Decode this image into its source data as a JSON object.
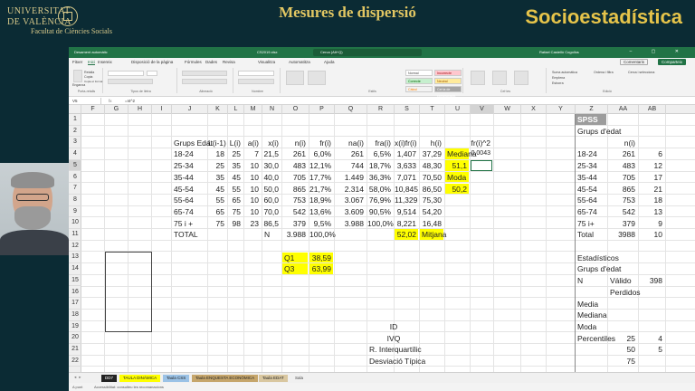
{
  "header": {
    "logo_line1": "UNIVERSITAT",
    "logo_line2": "DE VALÈNCIA",
    "logo_faculty": "Facultat de Ciències Socials",
    "title": "Mesures de dispersió",
    "brand": "Socioestadística"
  },
  "excel": {
    "titlebar": {
      "autosave": "Desament automàtic",
      "file": "CS2019.xlsx",
      "search": "Cerca (Alt+Q)",
      "user": "Rafael Castellò Cogollos",
      "controls": "–  ▢  ✕"
    },
    "menu": {
      "items": [
        "Fitxer",
        "Inici",
        "Insereix",
        "Disposició de la pàgina",
        "Fórmules",
        "Dades",
        "Revisa",
        "Visualitza",
        "Automatitza",
        "Ajuda"
      ],
      "active_index": 1,
      "comments": "Comentaris",
      "share": "Comparteix"
    },
    "ribbon": {
      "groups": [
        "Porta-retalls",
        "Tipus de lletra",
        "Alineació",
        "Nombre",
        "Estils",
        "Cel·les",
        "Edició"
      ],
      "paste": "Enganxa",
      "cut": "Retalla",
      "copy": "Copia",
      "format_painter": "Copia el format",
      "styles": {
        "normal": "Normal",
        "bad": "Incorrecte",
        "good": "Correcte",
        "neutral": "Neutral",
        "calc": "Càlcul",
        "check": "Cel·la de comprovació"
      },
      "autosum": "Suma automàtica",
      "fill": "Emplena",
      "clear": "Esborra",
      "sort": "Ordena i filtra",
      "find": "Cerca i selecciona"
    },
    "formula": {
      "namebox": "V5",
      "fx": "fx",
      "value": "=I4^2"
    },
    "columns": [
      "F",
      "G",
      "H",
      "I",
      "J",
      "K",
      "L",
      "M",
      "N",
      "O",
      "P",
      "Q",
      "R",
      "S",
      "T",
      "U",
      "V",
      "W",
      "X",
      "Y",
      "Z",
      "AA",
      "AB"
    ],
    "rows": [
      "1",
      "2",
      "3",
      "4",
      "5",
      "6",
      "7",
      "8",
      "9",
      "10",
      "11",
      "12",
      "13",
      "14",
      "15",
      "16",
      "17",
      "18",
      "19",
      "20",
      "21",
      "22"
    ],
    "table": {
      "headers": [
        "Grups Edat",
        "L(i-1)",
        "L(i)",
        "a(i)",
        "x(i)",
        "n(i)",
        "fr(i)",
        "na(i)",
        "fra(i)",
        "x(i)fr(i)",
        "h(i)"
      ],
      "rows": [
        [
          "18-24",
          "18",
          "25",
          "7",
          "21,5",
          "261",
          "6,0%",
          "261",
          "6,5%",
          "1,407",
          "37,29"
        ],
        [
          "25-34",
          "25",
          "35",
          "10",
          "30,0",
          "483",
          "12,1%",
          "744",
          "18,7%",
          "3,633",
          "48,30"
        ],
        [
          "35-44",
          "35",
          "45",
          "10",
          "40,0",
          "705",
          "17,7%",
          "1.449",
          "36,3%",
          "7,071",
          "70,50"
        ],
        [
          "45-54",
          "45",
          "55",
          "10",
          "50,0",
          "865",
          "21,7%",
          "2.314",
          "58,0%",
          "10,845",
          "86,50"
        ],
        [
          "55-64",
          "55",
          "65",
          "10",
          "60,0",
          "753",
          "18,9%",
          "3.067",
          "76,9%",
          "11,329",
          "75,30"
        ],
        [
          "65-74",
          "65",
          "75",
          "10",
          "70,0",
          "542",
          "13,6%",
          "3.609",
          "90,5%",
          "9,514",
          "54,20"
        ],
        [
          "75 i +",
          "75",
          "98",
          "23",
          "86,5",
          "379",
          "9,5%",
          "3.988",
          "100,0%",
          "8,221",
          "16,48"
        ]
      ],
      "total_label": "TOTAL",
      "n_label": "N",
      "total_n": "3.988",
      "total_fr": "100,0%",
      "mean_value": "52,02",
      "mean_label": "Mitjana"
    },
    "side": {
      "median_label": "Mediana",
      "median_value": "51,1",
      "mode_label": "Moda",
      "mode_value": "50,2",
      "fr2_header": "fr(i)^2",
      "fr2_value": "0,0043"
    },
    "quartiles": {
      "q1_label": "Q1",
      "q1_value": "38,59",
      "q3_label": "Q3",
      "q3_value": "63,99"
    },
    "measures": [
      "ID",
      "IVQ",
      "R. Interquartílic",
      "Desviació Típica"
    ],
    "spss": {
      "title": "SPSS",
      "subtitle": "Grups d'edat",
      "n_header": "n(i)",
      "rows": [
        [
          "18-24",
          "261",
          "6"
        ],
        [
          "25-34",
          "483",
          "12"
        ],
        [
          "35-44",
          "705",
          "17"
        ],
        [
          "45-54",
          "865",
          "21"
        ],
        [
          "55-64",
          "753",
          "18"
        ],
        [
          "65-74",
          "542",
          "13"
        ],
        [
          "75 i+",
          "379",
          "9"
        ],
        [
          "Total",
          "3988",
          "10"
        ]
      ],
      "stats_title": "Estadísticos",
      "stats_sub": "Grups d'edat",
      "n": "N",
      "valid": "Válido",
      "valid_value": "398",
      "lost": "Perdidos",
      "mean": "Media",
      "median": "Mediana",
      "mode": "Moda",
      "percentiles": "Percentiles",
      "p25": "25",
      "p25_v": "4",
      "p50": "50",
      "p50_v": "5",
      "p75": "75"
    },
    "sheet_tabs": [
      "DD7",
      "TAULA DINÀMICA",
      "Taula CSS",
      "Taula ENQUESTA ECONÒMICA",
      "Taula EDAT",
      "Sala"
    ],
    "status": {
      "ready": "A punt",
      "accessibility": "Accessibilitat: consulteu les recomanacions"
    }
  },
  "colors": {
    "excel_green": "#217346",
    "highlight": "#ffff00",
    "slide_bg": "#0b2b34",
    "title_gold": "#e2c763"
  }
}
